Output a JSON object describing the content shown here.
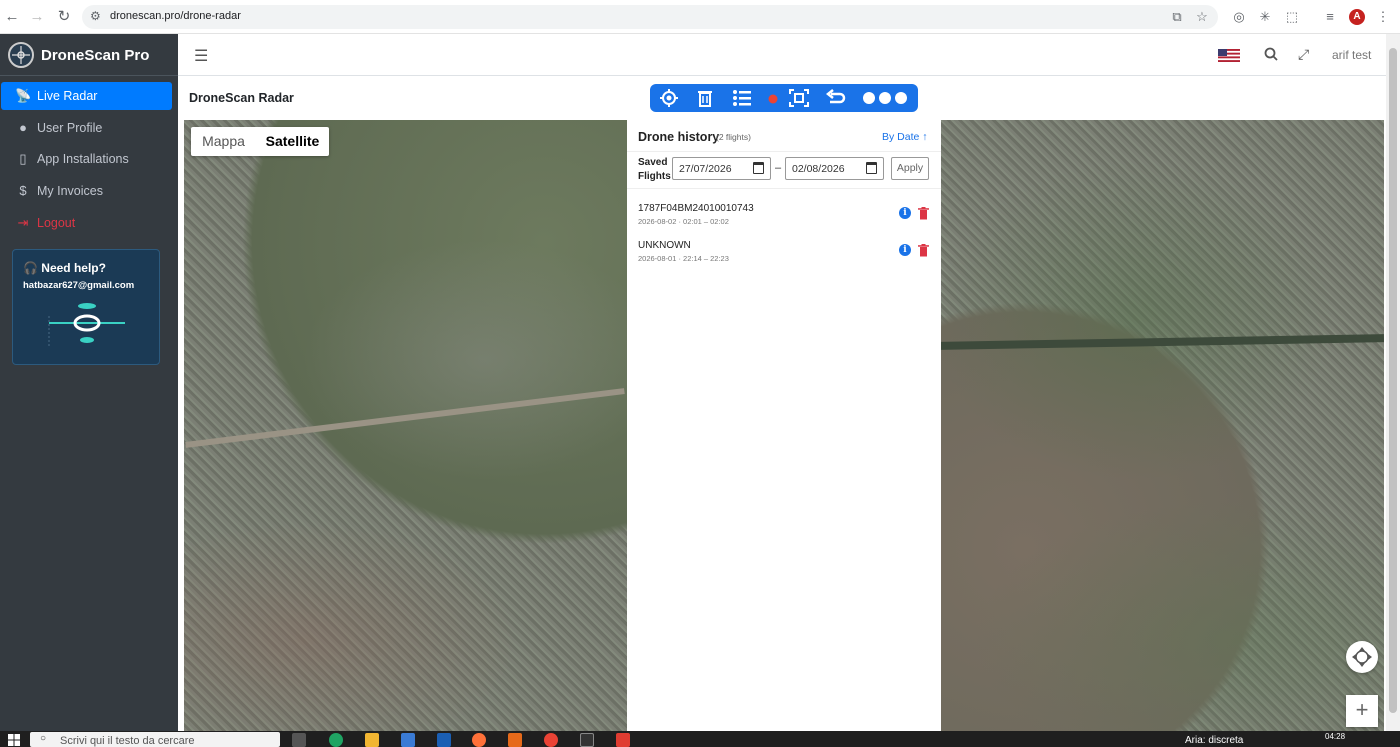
{
  "browser": {
    "url": "dronescan.pro/drone-radar"
  },
  "sidebar": {
    "brand": "DroneScan Pro",
    "items": [
      {
        "label": "Live Radar",
        "icon": "radar-icon"
      },
      {
        "label": "User Profile",
        "icon": "user-icon"
      },
      {
        "label": "App Installations",
        "icon": "phone-icon"
      },
      {
        "label": "My Invoices",
        "icon": "dollar-icon"
      },
      {
        "label": "Logout",
        "icon": "logout-icon"
      }
    ],
    "help": {
      "title": "Need help?",
      "email": "hatbazar627@gmail.com"
    }
  },
  "topbar": {
    "username": "arif test"
  },
  "page": {
    "title": "DroneScan Radar"
  },
  "map": {
    "type_buttons": [
      "Mappa",
      "Satellite"
    ],
    "selected_type": "Satellite"
  },
  "history": {
    "title": "Drone history",
    "count": "(2 flights)",
    "sort": "By Date ↑",
    "saved_label_1": "Saved",
    "saved_label_2": "Flights",
    "date_from": "27/07/2026",
    "date_to": "02/08/2026",
    "date_separator": "–",
    "apply": "Apply",
    "flights": [
      {
        "name": "1787F04BM24010010743",
        "time": "2026-08-02 · 02:01 – 02:02"
      },
      {
        "name": "UNKNOWN",
        "time": "2026-08-01 · 22:14 – 22:23"
      }
    ]
  },
  "taskbar": {
    "search_placeholder": "Scrivi qui il testo da cercare",
    "weather": "Aria: discreta",
    "time": "04:28"
  },
  "colors": {
    "primary": "#1a73e8",
    "sidebar": "#343a40",
    "active": "#007bff",
    "danger": "#dc3545"
  }
}
